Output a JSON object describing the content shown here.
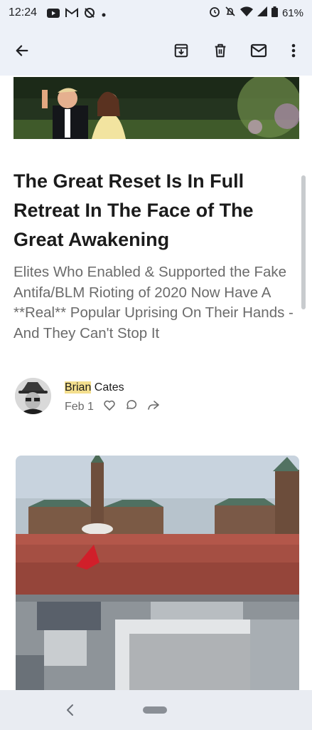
{
  "status_bar": {
    "time": "12:24",
    "battery": "61%",
    "left_icons": [
      "youtube-icon",
      "gmail-icon",
      "no-sync-icon",
      "dot-icon"
    ],
    "right_icons": [
      "alarm-icon",
      "mute-icon",
      "wifi-icon",
      "signal-icon",
      "battery-icon"
    ]
  },
  "toolbar": {
    "icons": [
      "back-arrow-icon",
      "archive-icon",
      "delete-icon",
      "mail-icon",
      "more-vert-icon"
    ]
  },
  "article": {
    "headline": "The Great Reset Is In Full Retreat In The Face of The Great Awakening",
    "subtitle": "Elites Who Enabled & Supported the Fake Antifa/BLM Rioting of 2020 Now Have A **Real** Popular Uprising On Their Hands - And They Can't Stop It",
    "author_first": "Brian",
    "author_last": " Cates",
    "date": "Feb 1",
    "meta_icons": [
      "heart-icon",
      "comment-icon",
      "share-icon"
    ]
  },
  "colors": {
    "bar_background": "#edf1f8",
    "highlight": "#f4df8e",
    "subtitle_gray": "#6b6b6b"
  }
}
